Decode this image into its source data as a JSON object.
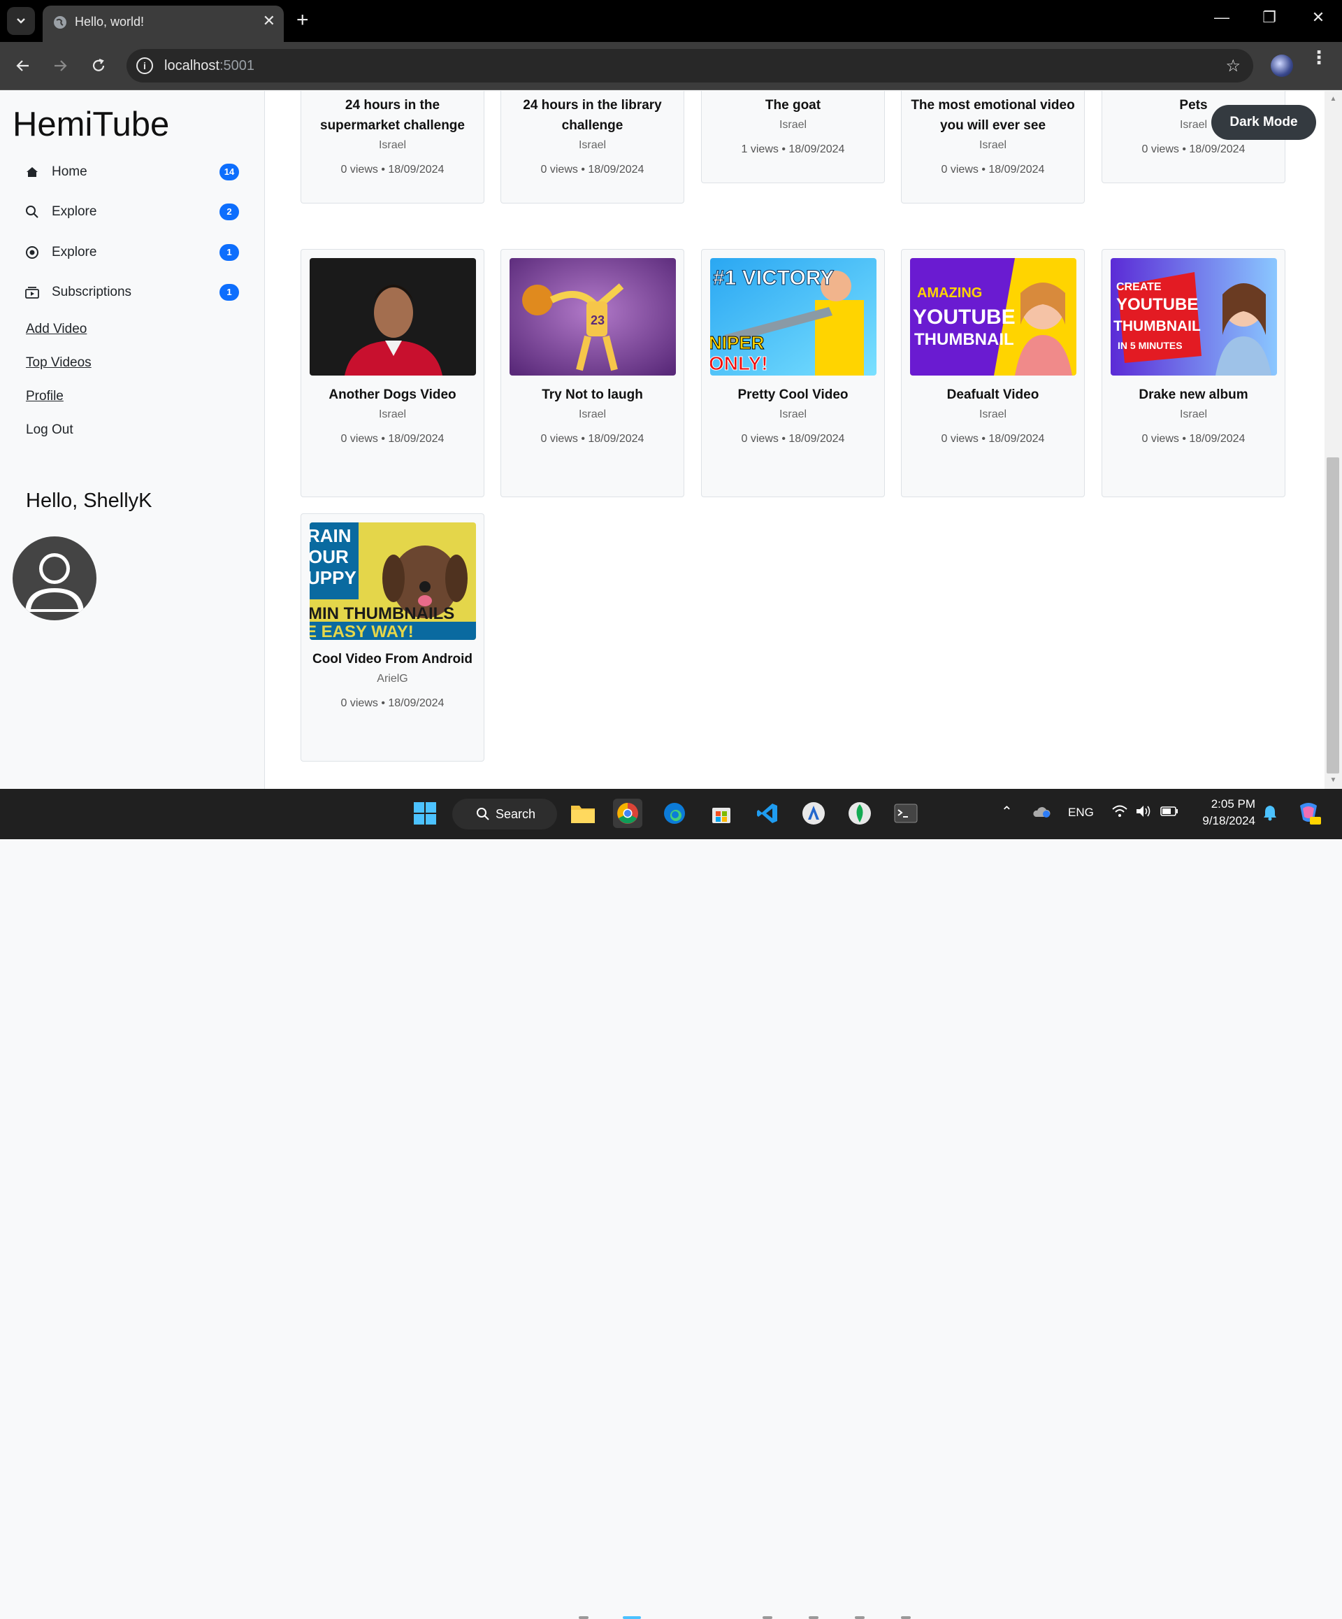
{
  "browser": {
    "tab_title": "Hello, world!",
    "url_host": "localhost",
    "url_port": ":5001"
  },
  "sidebar": {
    "brand": "HemiTube",
    "nav": [
      {
        "label": "Home",
        "badge": "14",
        "icon": "home-icon"
      },
      {
        "label": "Explore",
        "badge": "2",
        "icon": "search-icon"
      },
      {
        "label": "Explore",
        "badge": "1",
        "icon": "compass-icon"
      },
      {
        "label": "Subscriptions",
        "badge": "1",
        "icon": "subscriptions-icon"
      }
    ],
    "links": [
      "Add Video",
      "Top Videos",
      "Profile"
    ],
    "logout": "Log Out",
    "greeting": "Hello, ShellyK"
  },
  "dark_mode_label": "Dark Mode",
  "videos_row1": [
    {
      "title_l1": "24 hours in the",
      "title_l2": "supermarket challenge",
      "owner": "Israel",
      "meta": "0 views • 18/09/2024"
    },
    {
      "title_l1": "24 hours in the library",
      "title_l2": "challenge",
      "owner": "Israel",
      "meta": "0 views • 18/09/2024"
    },
    {
      "title_l1": "The goat",
      "title_l2": "",
      "owner": "Israel",
      "meta": "1 views • 18/09/2024"
    },
    {
      "title_l1": "The most emotional video",
      "title_l2": "you will ever see",
      "owner": "Israel",
      "meta": "0 views • 18/09/2024"
    },
    {
      "title_l1": "Pets",
      "title_l2": "",
      "owner": "Israel",
      "meta": "0 views • 18/09/2024"
    }
  ],
  "videos_row2": [
    {
      "title": "Another Dogs Video",
      "owner": "Israel",
      "meta": "0 views • 18/09/2024"
    },
    {
      "title": "Try Not to laugh",
      "owner": "Israel",
      "meta": "0 views • 18/09/2024"
    },
    {
      "title": "Pretty Cool Video",
      "owner": "Israel",
      "meta": "0 views • 18/09/2024"
    },
    {
      "title": "Deafualt Video",
      "owner": "Israel",
      "meta": "0 views • 18/09/2024"
    },
    {
      "title": "Drake new album",
      "owner": "Israel",
      "meta": "0 views • 18/09/2024"
    }
  ],
  "videos_row3": [
    {
      "title": "Cool Video From Android",
      "owner": "ArielG",
      "meta": "0 views • 18/09/2024"
    }
  ],
  "thumbnail_text": {
    "pretty_cool": [
      "#1 VICTORY",
      "NIPER",
      "ONLY!"
    ],
    "default": [
      "AMAZING",
      "YOUTUBE",
      "THUMBNAIL"
    ],
    "drake": [
      "CREATE",
      "YOUTUBE",
      "THUMBNAIL",
      "IN 5 MINUTES"
    ],
    "android": [
      "RAIN",
      "OUR",
      "UPPY",
      "MIN THUMBNAILS",
      "E EASY WAY!"
    ]
  },
  "taskbar": {
    "search_label": "Search",
    "language": "ENG",
    "time": "2:05 PM",
    "date": "9/18/2024"
  },
  "colors": {
    "badge": "#0d6efd",
    "dark_button": "#343a40"
  }
}
